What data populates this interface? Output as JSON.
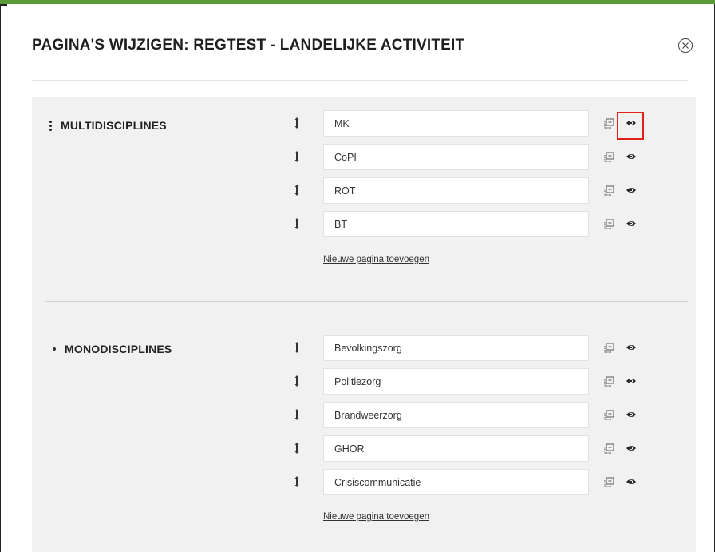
{
  "modal": {
    "title": "PAGINA'S WIJZIGEN: REGTEST - LANDELIJKE ACTIVITEIT",
    "close_icon": "close-circle-icon"
  },
  "groups": [
    {
      "title": "MULTIDISCIPLINES",
      "marker": "kebab-menu-icon",
      "pages": [
        "MK",
        "CoPI",
        "ROT",
        "BT"
      ],
      "add_label": "Nieuwe pagina toevoegen"
    },
    {
      "title": "MONODISCIPLINES",
      "marker": "bullet",
      "pages": [
        "Bevolkingszorg",
        "Politiezorg",
        "Brandweerzorg",
        "GHOR",
        "Crisiscommunicatie"
      ],
      "add_label": "Nieuwe pagina toevoegen"
    }
  ],
  "colors": {
    "accent_top": "#5b9a3b",
    "panel_bg": "#f1f1f1",
    "highlight": "#e0221b"
  },
  "row_icons": [
    "drag-handle-icon",
    "copy-icon",
    "eye-icon"
  ],
  "highlighted": "groups.0.pages.0 eye-icon"
}
